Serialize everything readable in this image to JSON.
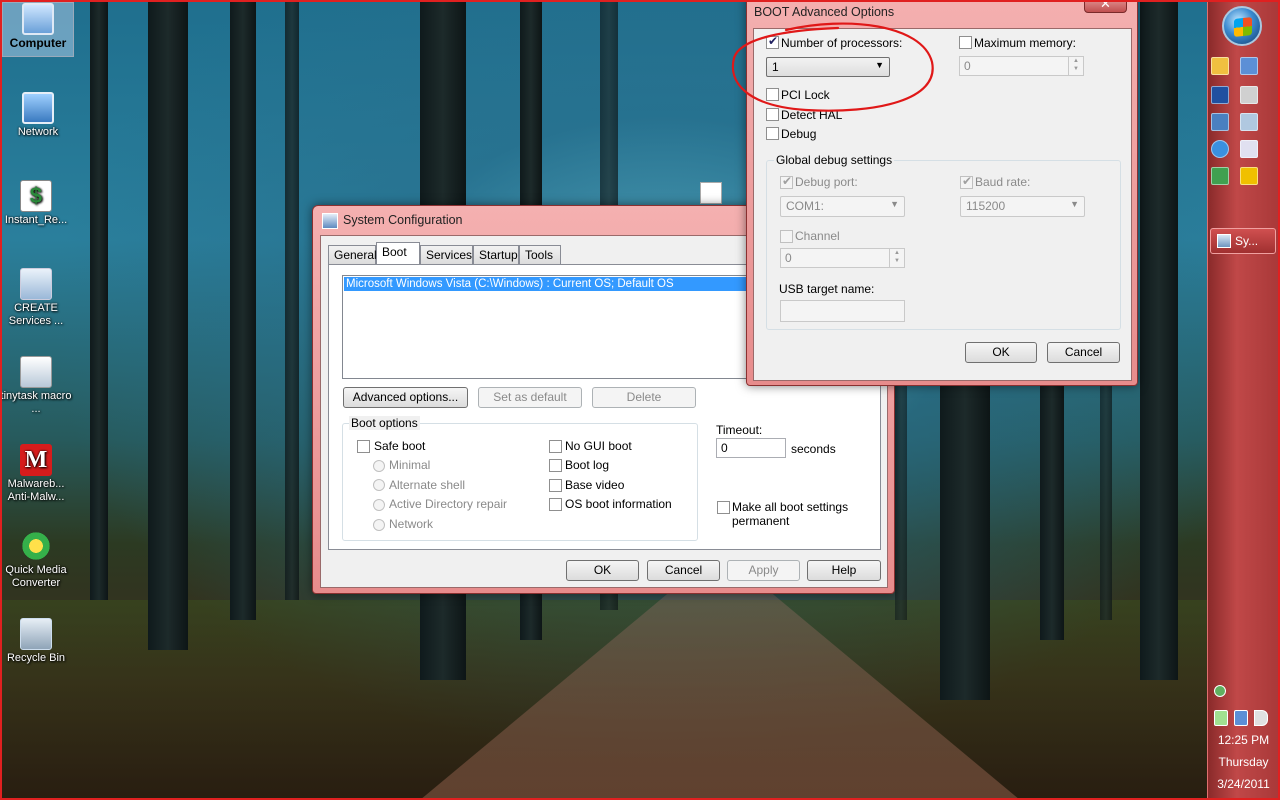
{
  "desktop": {
    "icons": [
      {
        "label": "Computer",
        "icon": "computer-icon"
      },
      {
        "label": "Network",
        "icon": "network-icon"
      },
      {
        "label": "Instant_Re...",
        "icon": "instant-recovery-icon"
      },
      {
        "label": "CREATE Services ...",
        "icon": "create-services-icon"
      },
      {
        "label": "tinytask macro ...",
        "icon": "tinytask-icon"
      },
      {
        "label": "Malwareb... Anti-Malw...",
        "icon": "malwarebytes-icon"
      },
      {
        "label": "Quick Media Converter",
        "icon": "quick-media-converter-icon"
      },
      {
        "label": "Recycle Bin",
        "icon": "recycle-bin-icon"
      }
    ]
  },
  "taskbar": {
    "running": [
      {
        "label": "Sy..."
      }
    ],
    "clock": {
      "time": "12:25 PM",
      "day": "Thursday",
      "date": "3/24/2011"
    }
  },
  "sysconfig": {
    "title": "System Configuration",
    "tabs": [
      "General",
      "Boot",
      "Services",
      "Startup",
      "Tools"
    ],
    "active_tab": "Boot",
    "os_list": [
      "Microsoft Windows Vista (C:\\Windows) : Current OS; Default OS"
    ],
    "buttons": {
      "advanced": "Advanced options...",
      "set_default": "Set as default",
      "delete": "Delete"
    },
    "boot_options": {
      "legend": "Boot options",
      "safe_boot": "Safe boot",
      "minimal": "Minimal",
      "alternate_shell": "Alternate shell",
      "ad_repair": "Active Directory repair",
      "network": "Network",
      "no_gui_boot": "No GUI boot",
      "boot_log": "Boot log",
      "base_video": "Base video",
      "os_boot_info": "OS boot information"
    },
    "timeout": {
      "label": "Timeout:",
      "value": "0",
      "unit": "seconds"
    },
    "make_permanent": "Make all boot settings permanent",
    "footer": {
      "ok": "OK",
      "cancel": "Cancel",
      "apply": "Apply",
      "help": "Help"
    }
  },
  "advanced": {
    "title": "BOOT Advanced Options",
    "close": "✕",
    "num_processors": {
      "label": "Number of processors:",
      "value": "1",
      "checked": true
    },
    "max_memory": {
      "label": "Maximum memory:",
      "value": "0",
      "checked": false
    },
    "pci_lock": "PCI Lock",
    "detect_hal": "Detect HAL",
    "debug": "Debug",
    "global_debug": {
      "legend": "Global debug settings",
      "debug_port": {
        "label": "Debug port:",
        "value": "COM1:"
      },
      "baud_rate": {
        "label": "Baud rate:",
        "value": "115200"
      },
      "channel": {
        "label": "Channel",
        "value": "0"
      },
      "usb_target": {
        "label": "USB target name:",
        "value": ""
      }
    },
    "ok": "OK",
    "cancel": "Cancel"
  },
  "colors": {
    "annotation": "#e01818",
    "aero_frame": "#e78c8c",
    "selection": "#3399ff"
  }
}
